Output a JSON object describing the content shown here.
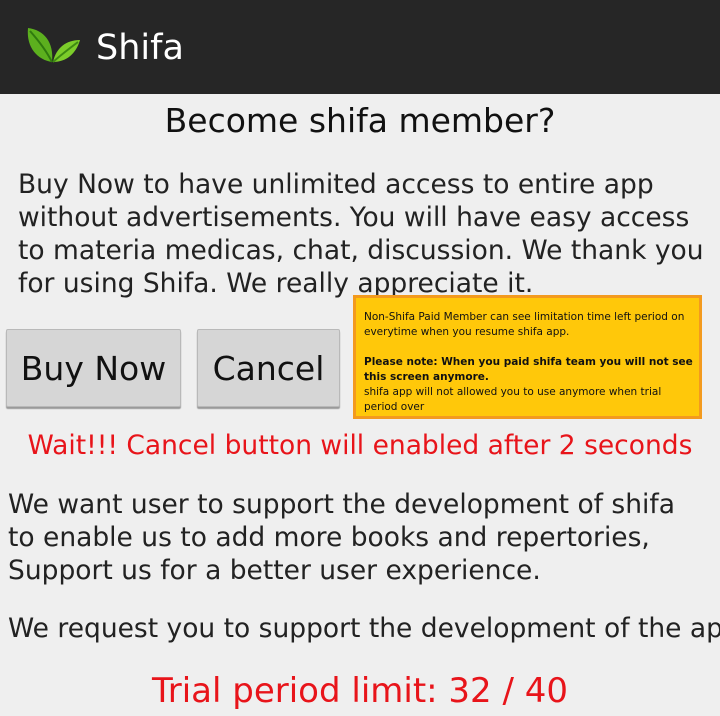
{
  "actionbar": {
    "title": "Shifa",
    "logo_icon": "leaf-icon",
    "background_color": "#262626"
  },
  "dialog": {
    "heading": "Become shifa member?",
    "intro": "Buy Now to have unlimited access to entire app without advertisements. You will have easy access to materia medicas, chat, discussion. We thank you for using Shifa. We really appreciate it.",
    "buy_button_label": "Buy Now",
    "cancel_button_label": "Cancel",
    "wait_message": "Wait!!! Cancel button will enabled after 2 seconds",
    "support_text": "We want user to support the development of shifa to enable us to add more books and repertories, Support us for a better user experience.",
    "request_text": "We request you to support the development of the app.",
    "trial_limit": "Trial period limit: 32 / 40",
    "accent_color": "#e8141a"
  },
  "note": {
    "line1": "Non-Shifa Paid Member can see limitation time left period on everytime when you resume shifa app.",
    "line2": "Please note: When you paid shifa team you will not see this screen anymore.",
    "line3": "shifa app will not allowed you to use anymore when trial period over",
    "background_color": "#ffc80a",
    "border_color": "#f39a1e"
  }
}
